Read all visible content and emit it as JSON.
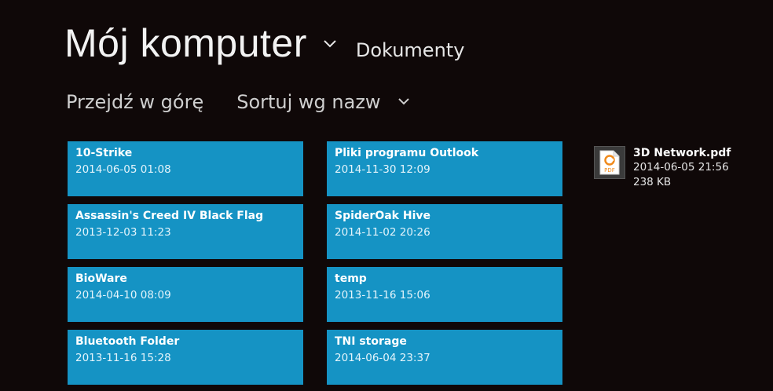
{
  "header": {
    "title": "Mój komputer",
    "location": "Dokumenty"
  },
  "commands": {
    "up": "Przejdź w górę",
    "sort": "Sortuj wg nazw"
  },
  "folders": [
    {
      "name": "10-Strike",
      "date": "2014-06-05 01:08"
    },
    {
      "name": "Assassin's Creed IV Black Flag",
      "date": "2013-12-03 11:23"
    },
    {
      "name": "BioWare",
      "date": "2014-04-10 08:09"
    },
    {
      "name": "Bluetooth Folder",
      "date": "2013-11-16 15:28"
    },
    {
      "name": "Pliki programu Outlook",
      "date": "2014-11-30 12:09"
    },
    {
      "name": "SpiderOak Hive",
      "date": "2014-11-02 20:26"
    },
    {
      "name": "temp",
      "date": "2013-11-16 15:06"
    },
    {
      "name": "TNI storage",
      "date": "2014-06-04 23:37"
    }
  ],
  "files": [
    {
      "name": "3D Network.pdf",
      "date": "2014-06-05 21:56",
      "size": "238 KB",
      "icon": "pdf-file-icon",
      "icon_label": "PDF"
    }
  ],
  "colors": {
    "background": "#0f0808",
    "tile": "#1593c4",
    "pdf_accent": "#f08a1c"
  }
}
